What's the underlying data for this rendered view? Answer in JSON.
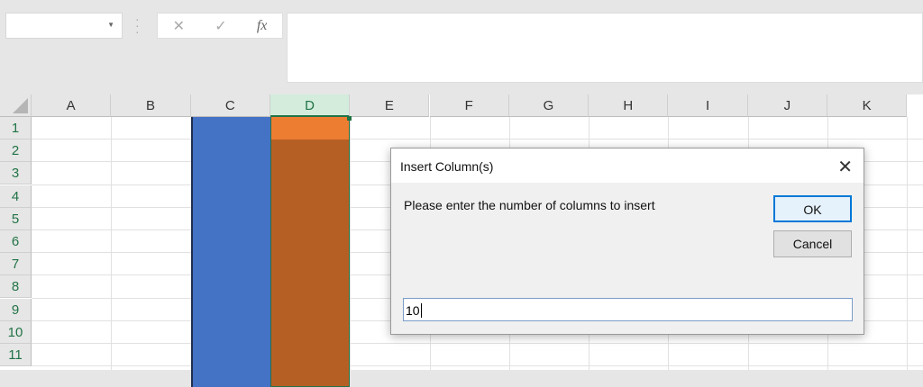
{
  "formula_bar": {
    "name_box": "",
    "cancel_icon": "✕",
    "enter_icon": "✓",
    "fx_label": "fx",
    "formula": ""
  },
  "columns": [
    "A",
    "B",
    "C",
    "D",
    "E",
    "F",
    "G",
    "H",
    "I",
    "J",
    "K"
  ],
  "selected_column": "D",
  "rows": [
    "1",
    "2",
    "3",
    "4",
    "5",
    "6",
    "7",
    "8",
    "9",
    "10",
    "11"
  ],
  "colors": {
    "column_c": "#4472c4",
    "column_d_top": "#ed7d31",
    "column_d": "#b65f24",
    "accent": "#217346"
  },
  "dialog": {
    "title": "Insert Column(s)",
    "message": "Please enter the number of columns to insert",
    "ok": "OK",
    "cancel": "Cancel",
    "input_value": "10",
    "close_icon": "✕"
  }
}
